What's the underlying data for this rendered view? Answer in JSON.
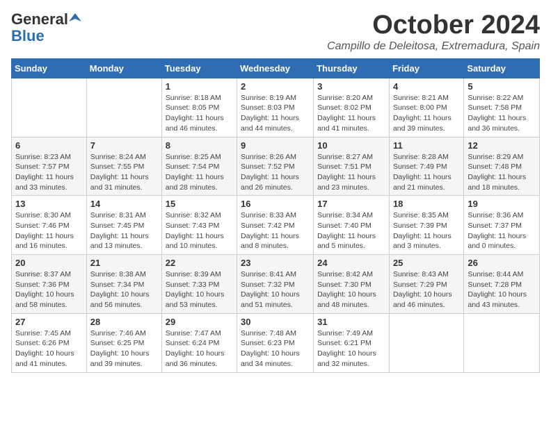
{
  "header": {
    "logo_general": "General",
    "logo_blue": "Blue",
    "month_title": "October 2024",
    "location": "Campillo de Deleitosa, Extremadura, Spain"
  },
  "weekdays": [
    "Sunday",
    "Monday",
    "Tuesday",
    "Wednesday",
    "Thursday",
    "Friday",
    "Saturday"
  ],
  "weeks": [
    [
      {
        "day": "",
        "info": ""
      },
      {
        "day": "",
        "info": ""
      },
      {
        "day": "1",
        "info": "Sunrise: 8:18 AM\nSunset: 8:05 PM\nDaylight: 11 hours and 46 minutes."
      },
      {
        "day": "2",
        "info": "Sunrise: 8:19 AM\nSunset: 8:03 PM\nDaylight: 11 hours and 44 minutes."
      },
      {
        "day": "3",
        "info": "Sunrise: 8:20 AM\nSunset: 8:02 PM\nDaylight: 11 hours and 41 minutes."
      },
      {
        "day": "4",
        "info": "Sunrise: 8:21 AM\nSunset: 8:00 PM\nDaylight: 11 hours and 39 minutes."
      },
      {
        "day": "5",
        "info": "Sunrise: 8:22 AM\nSunset: 7:58 PM\nDaylight: 11 hours and 36 minutes."
      }
    ],
    [
      {
        "day": "6",
        "info": "Sunrise: 8:23 AM\nSunset: 7:57 PM\nDaylight: 11 hours and 33 minutes."
      },
      {
        "day": "7",
        "info": "Sunrise: 8:24 AM\nSunset: 7:55 PM\nDaylight: 11 hours and 31 minutes."
      },
      {
        "day": "8",
        "info": "Sunrise: 8:25 AM\nSunset: 7:54 PM\nDaylight: 11 hours and 28 minutes."
      },
      {
        "day": "9",
        "info": "Sunrise: 8:26 AM\nSunset: 7:52 PM\nDaylight: 11 hours and 26 minutes."
      },
      {
        "day": "10",
        "info": "Sunrise: 8:27 AM\nSunset: 7:51 PM\nDaylight: 11 hours and 23 minutes."
      },
      {
        "day": "11",
        "info": "Sunrise: 8:28 AM\nSunset: 7:49 PM\nDaylight: 11 hours and 21 minutes."
      },
      {
        "day": "12",
        "info": "Sunrise: 8:29 AM\nSunset: 7:48 PM\nDaylight: 11 hours and 18 minutes."
      }
    ],
    [
      {
        "day": "13",
        "info": "Sunrise: 8:30 AM\nSunset: 7:46 PM\nDaylight: 11 hours and 16 minutes."
      },
      {
        "day": "14",
        "info": "Sunrise: 8:31 AM\nSunset: 7:45 PM\nDaylight: 11 hours and 13 minutes."
      },
      {
        "day": "15",
        "info": "Sunrise: 8:32 AM\nSunset: 7:43 PM\nDaylight: 11 hours and 10 minutes."
      },
      {
        "day": "16",
        "info": "Sunrise: 8:33 AM\nSunset: 7:42 PM\nDaylight: 11 hours and 8 minutes."
      },
      {
        "day": "17",
        "info": "Sunrise: 8:34 AM\nSunset: 7:40 PM\nDaylight: 11 hours and 5 minutes."
      },
      {
        "day": "18",
        "info": "Sunrise: 8:35 AM\nSunset: 7:39 PM\nDaylight: 11 hours and 3 minutes."
      },
      {
        "day": "19",
        "info": "Sunrise: 8:36 AM\nSunset: 7:37 PM\nDaylight: 11 hours and 0 minutes."
      }
    ],
    [
      {
        "day": "20",
        "info": "Sunrise: 8:37 AM\nSunset: 7:36 PM\nDaylight: 10 hours and 58 minutes."
      },
      {
        "day": "21",
        "info": "Sunrise: 8:38 AM\nSunset: 7:34 PM\nDaylight: 10 hours and 56 minutes."
      },
      {
        "day": "22",
        "info": "Sunrise: 8:39 AM\nSunset: 7:33 PM\nDaylight: 10 hours and 53 minutes."
      },
      {
        "day": "23",
        "info": "Sunrise: 8:41 AM\nSunset: 7:32 PM\nDaylight: 10 hours and 51 minutes."
      },
      {
        "day": "24",
        "info": "Sunrise: 8:42 AM\nSunset: 7:30 PM\nDaylight: 10 hours and 48 minutes."
      },
      {
        "day": "25",
        "info": "Sunrise: 8:43 AM\nSunset: 7:29 PM\nDaylight: 10 hours and 46 minutes."
      },
      {
        "day": "26",
        "info": "Sunrise: 8:44 AM\nSunset: 7:28 PM\nDaylight: 10 hours and 43 minutes."
      }
    ],
    [
      {
        "day": "27",
        "info": "Sunrise: 7:45 AM\nSunset: 6:26 PM\nDaylight: 10 hours and 41 minutes."
      },
      {
        "day": "28",
        "info": "Sunrise: 7:46 AM\nSunset: 6:25 PM\nDaylight: 10 hours and 39 minutes."
      },
      {
        "day": "29",
        "info": "Sunrise: 7:47 AM\nSunset: 6:24 PM\nDaylight: 10 hours and 36 minutes."
      },
      {
        "day": "30",
        "info": "Sunrise: 7:48 AM\nSunset: 6:23 PM\nDaylight: 10 hours and 34 minutes."
      },
      {
        "day": "31",
        "info": "Sunrise: 7:49 AM\nSunset: 6:21 PM\nDaylight: 10 hours and 32 minutes."
      },
      {
        "day": "",
        "info": ""
      },
      {
        "day": "",
        "info": ""
      }
    ]
  ]
}
